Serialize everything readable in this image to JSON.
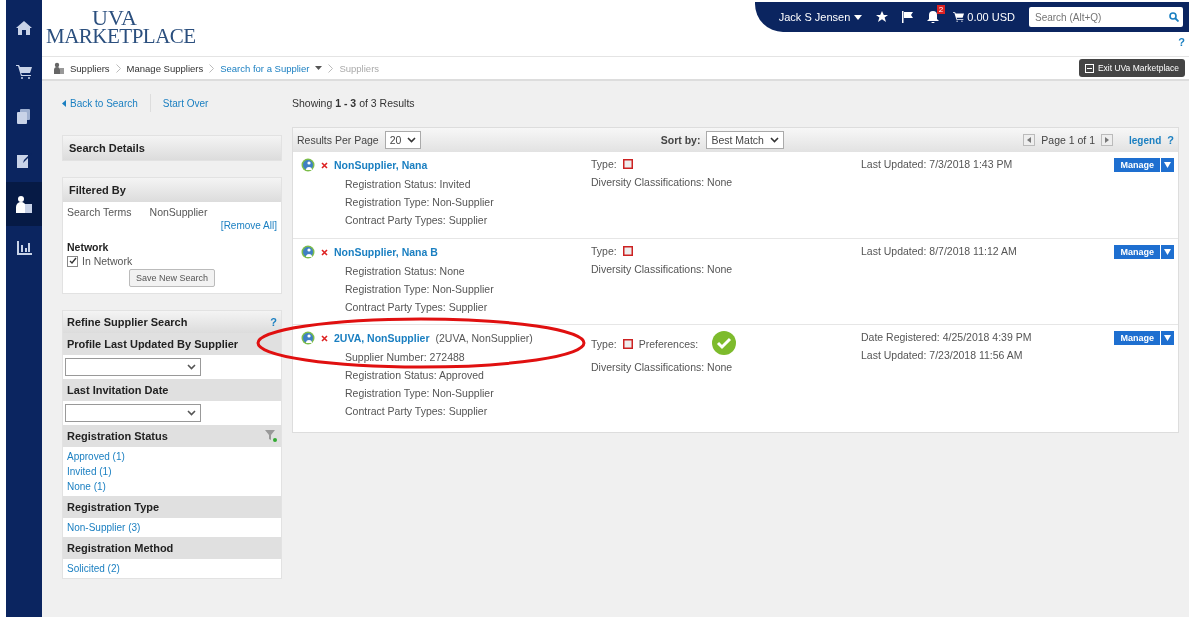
{
  "nav_rail": {
    "items": [
      {
        "selected": false
      },
      {
        "selected": false
      },
      {
        "selected": false
      },
      {
        "selected": false
      },
      {
        "selected": true
      },
      {
        "selected": false
      }
    ]
  },
  "logo": {
    "line_1": "UVA",
    "line_2": "MARKETPLACE"
  },
  "header": {
    "user": "Jack S Jensen",
    "notification_count": "2",
    "cart_total": "0.00 USD",
    "search": {
      "placeholder": "Search (Alt+Q)"
    },
    "help": "?"
  },
  "breadcrumb": [
    {
      "label": "Suppliers",
      "kind": "text"
    },
    {
      "label": "Manage Suppliers",
      "kind": "text"
    },
    {
      "label": "Search for a Supplier",
      "kind": "link"
    },
    {
      "label": "Suppliers",
      "kind": "current"
    }
  ],
  "exit_button": "Exit UVa Marketplace",
  "back_link": "Back to Search",
  "start_over_link": "Start Over",
  "results_summary": "Showing **1 - 3** of 3 Results",
  "search_details": {
    "title": "Search Details"
  },
  "filtered_by": {
    "title": "Filtered By",
    "terms_label": "Search Terms",
    "terms_value": "NonSupplier",
    "remove_all": "[Remove All]",
    "network_label": "Network",
    "in_network": {
      "label": "In Network",
      "checked": true
    },
    "save_button": "Save New Search"
  },
  "refine": {
    "title": "Refine Supplier Search",
    "help": "?",
    "sections": [
      {
        "title": "Profile Last Updated By Supplier",
        "kind": "select",
        "filter": false
      },
      {
        "title": "Last Invitation Date",
        "kind": "select",
        "filter": false
      },
      {
        "title": "Registration Status",
        "kind": "links",
        "filter": true,
        "links": [
          "Approved (1)",
          "Invited (1)",
          "None (1)"
        ]
      },
      {
        "title": "Registration Type",
        "kind": "links",
        "filter": false,
        "links": [
          "Non-Supplier (3)"
        ]
      },
      {
        "title": "Registration Method",
        "kind": "links",
        "filter": false,
        "links": [
          "Solicited (2)"
        ]
      }
    ]
  },
  "results": {
    "per_page_label": "Results Per Page",
    "per_page_value": "20",
    "sort_label": "Sort by:",
    "sort_value": "Best Match",
    "page_text": "Page 1 of 1",
    "legend": "legend",
    "help": "?",
    "rows": [
      {
        "name": "NonSupplier, Nana",
        "details": [
          "Registration Status: Invited",
          "Registration Type: Non-Supplier",
          "Contract Party Types: Supplier"
        ],
        "type_label": "Type:",
        "diversity": "Diversity Classifications: None",
        "dates": [
          "Last Updated: 7/3/2018 1:43 PM"
        ],
        "manage": "Manage"
      },
      {
        "name": "NonSupplier, Nana B",
        "details": [
          "Registration Status: None",
          "Registration Type: Non-Supplier",
          "Contract Party Types: Supplier"
        ],
        "type_label": "Type:",
        "diversity": "Diversity Classifications: None",
        "dates": [
          "Last Updated: 8/7/2018 11:12 AM"
        ],
        "manage": "Manage"
      },
      {
        "name": "2UVA, NonSupplier",
        "alias": "(2UVA, NonSupplier)",
        "details": [
          "Supplier Number: 272488",
          "Registration Status: Approved",
          "Registration Type: Non-Supplier",
          "Contract Party Types: Supplier"
        ],
        "type_label": "Type:",
        "preferences_label": "Preferences:",
        "diversity": "Diversity Classifications: None",
        "dates": [
          "Date Registered: 4/25/2018 4:39 PM",
          "Last Updated: 7/23/2018 11:56 AM"
        ],
        "manage": "Manage"
      }
    ]
  }
}
